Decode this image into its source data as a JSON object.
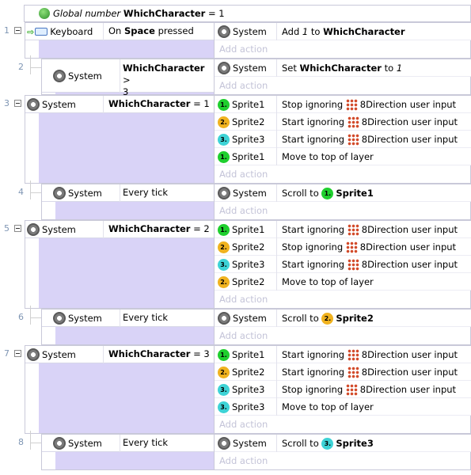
{
  "global_var": {
    "prefix": "Global number",
    "name": "WhichCharacter",
    "suffix": "= 1"
  },
  "add_action": "Add action",
  "events": [
    {
      "num": "1",
      "cond_obj": "Keyboard",
      "cond_pre": "On",
      "cond_bold": "Space",
      "cond_post": "pressed",
      "actions": [
        {
          "obj": "System",
          "pre": "Add",
          "italic": "1",
          "mid": "to",
          "bold": "WhichCharacter"
        }
      ]
    },
    {
      "num": "2",
      "cond_obj": "System",
      "cond_bold": "WhichCharacter",
      "cond_post": ">",
      "cond_line2": "3",
      "actions": [
        {
          "obj": "System",
          "pre": "Set",
          "bold": "WhichCharacter",
          "mid": "to",
          "italic": "1"
        }
      ]
    },
    {
      "num": "3",
      "cond_obj": "System",
      "cond_bold": "WhichCharacter",
      "cond_post": "= 1",
      "actions": [
        {
          "obj": "Sprite1",
          "badge": "1",
          "text": "Stop ignoring",
          "behavior": "8Direction user input"
        },
        {
          "obj": "Sprite2",
          "badge": "2",
          "text": "Start ignoring",
          "behavior": "8Direction user input"
        },
        {
          "obj": "Sprite3",
          "badge": "3",
          "text": "Start ignoring",
          "behavior": "8Direction user input"
        },
        {
          "obj": "Sprite1",
          "badge": "1",
          "text": "Move to top of layer"
        }
      ]
    },
    {
      "num": "4",
      "cond_obj": "System",
      "cond_text": "Every tick",
      "actions": [
        {
          "obj": "System",
          "pre": "Scroll to",
          "target_badge": "1",
          "bold": "Sprite1"
        }
      ]
    },
    {
      "num": "5",
      "cond_obj": "System",
      "cond_bold": "WhichCharacter",
      "cond_post": "= 2",
      "actions": [
        {
          "obj": "Sprite1",
          "badge": "1",
          "text": "Start ignoring",
          "behavior": "8Direction user input"
        },
        {
          "obj": "Sprite2",
          "badge": "2",
          "text": "Stop ignoring",
          "behavior": "8Direction user input"
        },
        {
          "obj": "Sprite3",
          "badge": "3",
          "text": "Start ignoring",
          "behavior": "8Direction user input"
        },
        {
          "obj": "Sprite2",
          "badge": "2",
          "text": "Move to top of layer"
        }
      ]
    },
    {
      "num": "6",
      "cond_obj": "System",
      "cond_text": "Every tick",
      "actions": [
        {
          "obj": "System",
          "pre": "Scroll to",
          "target_badge": "2",
          "bold": "Sprite2"
        }
      ]
    },
    {
      "num": "7",
      "cond_obj": "System",
      "cond_bold": "WhichCharacter",
      "cond_post": "= 3",
      "actions": [
        {
          "obj": "Sprite1",
          "badge": "1",
          "text": "Start ignoring",
          "behavior": "8Direction user input"
        },
        {
          "obj": "Sprite2",
          "badge": "2",
          "text": "Start ignoring",
          "behavior": "8Direction user input"
        },
        {
          "obj": "Sprite3",
          "badge": "3",
          "text": "Stop ignoring",
          "behavior": "8Direction user input"
        },
        {
          "obj": "Sprite3",
          "badge": "3",
          "text": "Move to top of layer"
        }
      ]
    },
    {
      "num": "8",
      "cond_obj": "System",
      "cond_text": "Every tick",
      "actions": [
        {
          "obj": "System",
          "pre": "Scroll to",
          "target_badge": "3",
          "bold": "Sprite3"
        }
      ]
    }
  ]
}
